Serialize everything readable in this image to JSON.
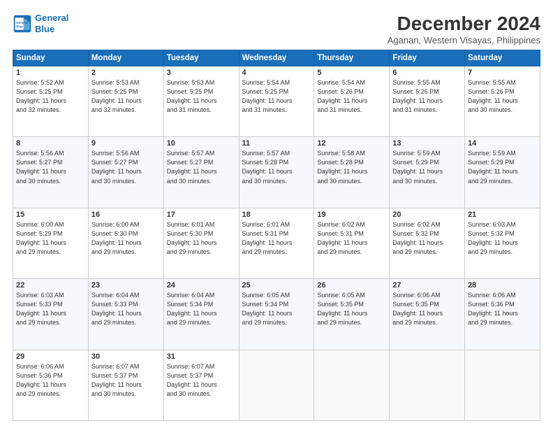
{
  "logo": {
    "line1": "General",
    "line2": "Blue"
  },
  "title": "December 2024",
  "location": "Aganan, Western Visayas, Philippines",
  "weekdays": [
    "Sunday",
    "Monday",
    "Tuesday",
    "Wednesday",
    "Thursday",
    "Friday",
    "Saturday"
  ],
  "weeks": [
    [
      {
        "day": "1",
        "text": "Sunrise: 5:52 AM\nSunset: 5:25 PM\nDaylight: 11 hours\nand 32 minutes."
      },
      {
        "day": "2",
        "text": "Sunrise: 5:53 AM\nSunset: 5:25 PM\nDaylight: 11 hours\nand 32 minutes."
      },
      {
        "day": "3",
        "text": "Sunrise: 5:53 AM\nSunset: 5:25 PM\nDaylight: 11 hours\nand 31 minutes."
      },
      {
        "day": "4",
        "text": "Sunrise: 5:54 AM\nSunset: 5:25 PM\nDaylight: 11 hours\nand 31 minutes."
      },
      {
        "day": "5",
        "text": "Sunrise: 5:54 AM\nSunset: 5:26 PM\nDaylight: 11 hours\nand 31 minutes."
      },
      {
        "day": "6",
        "text": "Sunrise: 5:55 AM\nSunset: 5:26 PM\nDaylight: 11 hours\nand 31 minutes."
      },
      {
        "day": "7",
        "text": "Sunrise: 5:55 AM\nSunset: 5:26 PM\nDaylight: 11 hours\nand 30 minutes."
      }
    ],
    [
      {
        "day": "8",
        "text": "Sunrise: 5:56 AM\nSunset: 5:27 PM\nDaylight: 11 hours\nand 30 minutes."
      },
      {
        "day": "9",
        "text": "Sunrise: 5:56 AM\nSunset: 5:27 PM\nDaylight: 11 hours\nand 30 minutes."
      },
      {
        "day": "10",
        "text": "Sunrise: 5:57 AM\nSunset: 5:27 PM\nDaylight: 11 hours\nand 30 minutes."
      },
      {
        "day": "11",
        "text": "Sunrise: 5:57 AM\nSunset: 5:28 PM\nDaylight: 11 hours\nand 30 minutes."
      },
      {
        "day": "12",
        "text": "Sunrise: 5:58 AM\nSunset: 5:28 PM\nDaylight: 11 hours\nand 30 minutes."
      },
      {
        "day": "13",
        "text": "Sunrise: 5:59 AM\nSunset: 5:29 PM\nDaylight: 11 hours\nand 30 minutes."
      },
      {
        "day": "14",
        "text": "Sunrise: 5:59 AM\nSunset: 5:29 PM\nDaylight: 11 hours\nand 29 minutes."
      }
    ],
    [
      {
        "day": "15",
        "text": "Sunrise: 6:00 AM\nSunset: 5:29 PM\nDaylight: 11 hours\nand 29 minutes."
      },
      {
        "day": "16",
        "text": "Sunrise: 6:00 AM\nSunset: 5:30 PM\nDaylight: 11 hours\nand 29 minutes."
      },
      {
        "day": "17",
        "text": "Sunrise: 6:01 AM\nSunset: 5:30 PM\nDaylight: 11 hours\nand 29 minutes."
      },
      {
        "day": "18",
        "text": "Sunrise: 6:01 AM\nSunset: 5:31 PM\nDaylight: 11 hours\nand 29 minutes."
      },
      {
        "day": "19",
        "text": "Sunrise: 6:02 AM\nSunset: 5:31 PM\nDaylight: 11 hours\nand 29 minutes."
      },
      {
        "day": "20",
        "text": "Sunrise: 6:02 AM\nSunset: 5:32 PM\nDaylight: 11 hours\nand 29 minutes."
      },
      {
        "day": "21",
        "text": "Sunrise: 6:03 AM\nSunset: 5:32 PM\nDaylight: 11 hours\nand 29 minutes."
      }
    ],
    [
      {
        "day": "22",
        "text": "Sunrise: 6:03 AM\nSunset: 5:33 PM\nDaylight: 11 hours\nand 29 minutes."
      },
      {
        "day": "23",
        "text": "Sunrise: 6:04 AM\nSunset: 5:33 PM\nDaylight: 11 hours\nand 29 minutes."
      },
      {
        "day": "24",
        "text": "Sunrise: 6:04 AM\nSunset: 5:34 PM\nDaylight: 11 hours\nand 29 minutes."
      },
      {
        "day": "25",
        "text": "Sunrise: 6:05 AM\nSunset: 5:34 PM\nDaylight: 11 hours\nand 29 minutes."
      },
      {
        "day": "26",
        "text": "Sunrise: 6:05 AM\nSunset: 5:35 PM\nDaylight: 11 hours\nand 29 minutes."
      },
      {
        "day": "27",
        "text": "Sunrise: 6:06 AM\nSunset: 5:35 PM\nDaylight: 11 hours\nand 29 minutes."
      },
      {
        "day": "28",
        "text": "Sunrise: 6:06 AM\nSunset: 5:36 PM\nDaylight: 11 hours\nand 29 minutes."
      }
    ],
    [
      {
        "day": "29",
        "text": "Sunrise: 6:06 AM\nSunset: 5:36 PM\nDaylight: 11 hours\nand 29 minutes."
      },
      {
        "day": "30",
        "text": "Sunrise: 6:07 AM\nSunset: 5:37 PM\nDaylight: 11 hours\nand 30 minutes."
      },
      {
        "day": "31",
        "text": "Sunrise: 6:07 AM\nSunset: 5:37 PM\nDaylight: 11 hours\nand 30 minutes."
      },
      {
        "day": "",
        "text": ""
      },
      {
        "day": "",
        "text": ""
      },
      {
        "day": "",
        "text": ""
      },
      {
        "day": "",
        "text": ""
      }
    ]
  ]
}
